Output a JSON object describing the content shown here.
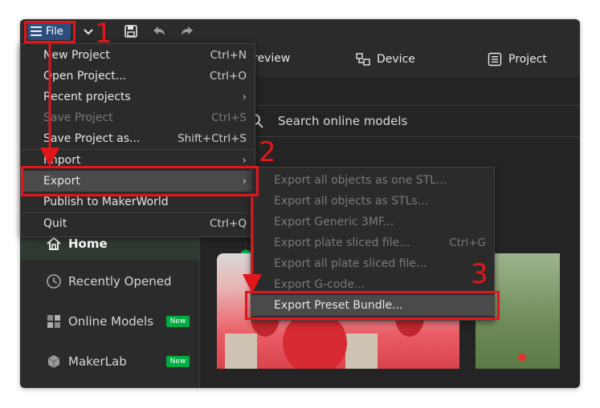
{
  "titlebar": {
    "file_label": "File"
  },
  "nav": {
    "tabs": [
      {
        "label": "review",
        "icon": "preview-icon"
      },
      {
        "label": "Device",
        "icon": "device-icon"
      },
      {
        "label": "Project",
        "icon": "project-icon"
      }
    ]
  },
  "search": {
    "placeholder": "Search online models"
  },
  "sidebar": {
    "items": [
      {
        "label": "Home",
        "icon": "home-icon",
        "active": true
      },
      {
        "label": "Recently Opened",
        "icon": "clock-icon"
      },
      {
        "label": "Online Models",
        "icon": "cube-grid-icon",
        "badge": "New"
      },
      {
        "label": "MakerLab",
        "icon": "maker-cube-icon",
        "badge": "New"
      }
    ]
  },
  "file_menu": {
    "items": [
      {
        "label": "New Project",
        "shortcut": "Ctrl+N"
      },
      {
        "label": "Open Project...",
        "shortcut": "Ctrl+O"
      },
      {
        "label": "Recent projects",
        "shortcut": "›"
      },
      {
        "label": "Save Project",
        "shortcut": "Ctrl+S",
        "disabled": true
      },
      {
        "label": "Save Project as...",
        "shortcut": "Shift+Ctrl+S"
      },
      {
        "label": "Import",
        "shortcut": "›"
      },
      {
        "label": "Export",
        "shortcut": "›",
        "highlighted": true
      },
      {
        "label": "Publish to MakerWorld",
        "shortcut": ""
      },
      {
        "label": "Quit",
        "shortcut": "Ctrl+Q"
      }
    ]
  },
  "export_menu": {
    "items": [
      {
        "label": "Export all objects as one STL...",
        "shortcut": "",
        "disabled": true
      },
      {
        "label": "Export all objects as STLs...",
        "shortcut": "",
        "disabled": true
      },
      {
        "label": "Export Generic 3MF...",
        "shortcut": "",
        "disabled": true
      },
      {
        "label": "Export plate sliced file...",
        "shortcut": "Ctrl+G",
        "disabled": true
      },
      {
        "label": "Export all plate sliced file...",
        "shortcut": "",
        "disabled": true
      },
      {
        "label": "Export G-code...",
        "shortcut": "",
        "disabled": true
      },
      {
        "label": "Export Preset Bundle...",
        "shortcut": "",
        "highlighted": true
      }
    ]
  },
  "annotations": [
    "1",
    "2",
    "3"
  ],
  "colors": {
    "annotation": "#e0161b",
    "accent": "#00ae42",
    "file_button": "#2d4e7c"
  }
}
